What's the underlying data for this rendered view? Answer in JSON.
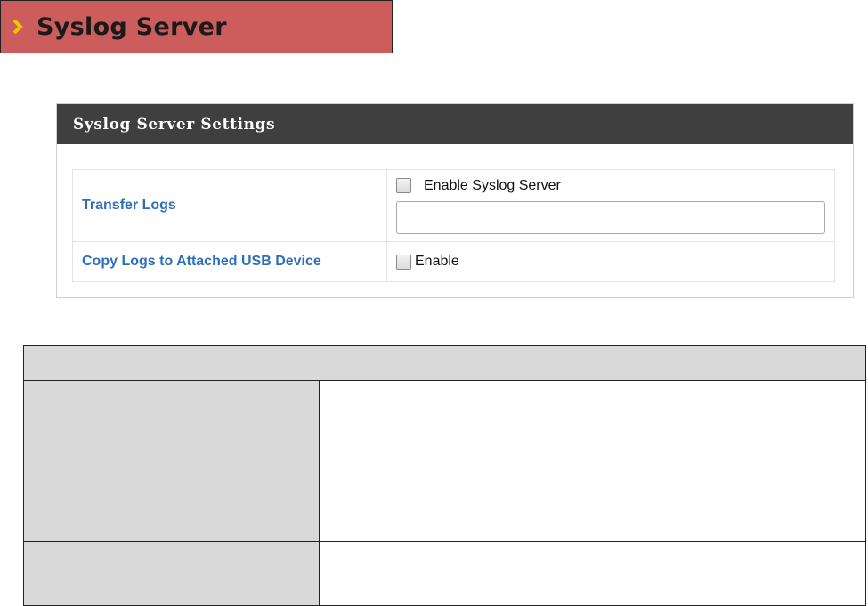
{
  "page": {
    "title": "Syslog Server",
    "header_bg": "#cd5c5c",
    "chevron_color": "#f5c400"
  },
  "panel": {
    "title": "Syslog Server Settings",
    "rows": [
      {
        "label": "Transfer Logs",
        "checkbox_label": "Enable Syslog Server",
        "checked": false,
        "input_value": "",
        "input_placeholder": ""
      },
      {
        "label": "Copy Logs to Attached USB Device",
        "checkbox_label": "Enable",
        "checked": false
      }
    ],
    "label_color": "#2f6fb8",
    "head_bg": "#3f3f3f"
  },
  "description_table": {
    "header": "",
    "rows": [
      {
        "field": "",
        "description": ""
      },
      {
        "field": "",
        "description": ""
      }
    ]
  }
}
